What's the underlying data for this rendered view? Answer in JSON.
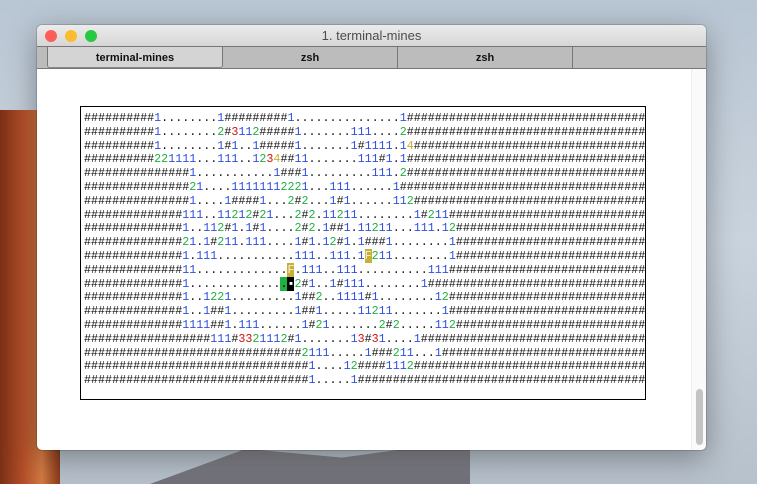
{
  "window": {
    "title": "1. terminal-mines"
  },
  "tabs": [
    {
      "label": "terminal-mines",
      "active": true
    },
    {
      "label": "zsh"
    },
    {
      "label": "zsh"
    }
  ],
  "colors": {
    "one": "#3050e0",
    "two": "#20b040",
    "three": "#d01010",
    "four": "#c8b030",
    "flag": "#c8b030"
  },
  "board": {
    "cursor": {
      "row": 12,
      "col": 29
    },
    "highlight": {
      "row": 12,
      "col": 28
    },
    "rows": [
      "##########1........1#########1...............1",
      "##########1........2#3112#####1.......111....2",
      "##########1........1#1..1#####1.......1#1111.14",
      "##########221111...111..1234##11.......111#1.1",
      "###############1...........1###1.........111.2",
      "###############21....11111112221...111......1",
      "###############1....1####1...2#2...1#1......112",
      "##############111..11212#21...2#2.11211........1#211",
      "##############1..112#1.1#1....2#2.1##1.11211...111.12",
      "##############21.1#211.111....1#1.12#1.1###1........1",
      "##############1.111...........111..111.1F211........1",
      "##############11.............F.111..111..........111",
      "##############1..............12#1..1#111........1",
      "##############1..1221.........1##2..1111#1........12",
      "##############1..1##1.........1##1.....11211.......1",
      "##############1111##1.111......1#21.......2#2.....112",
      "##################111#3321112#1.......13#31....1",
      "###############################2111.....1###211...1",
      "################################1....12####1112",
      "################################1.....1"
    ]
  }
}
